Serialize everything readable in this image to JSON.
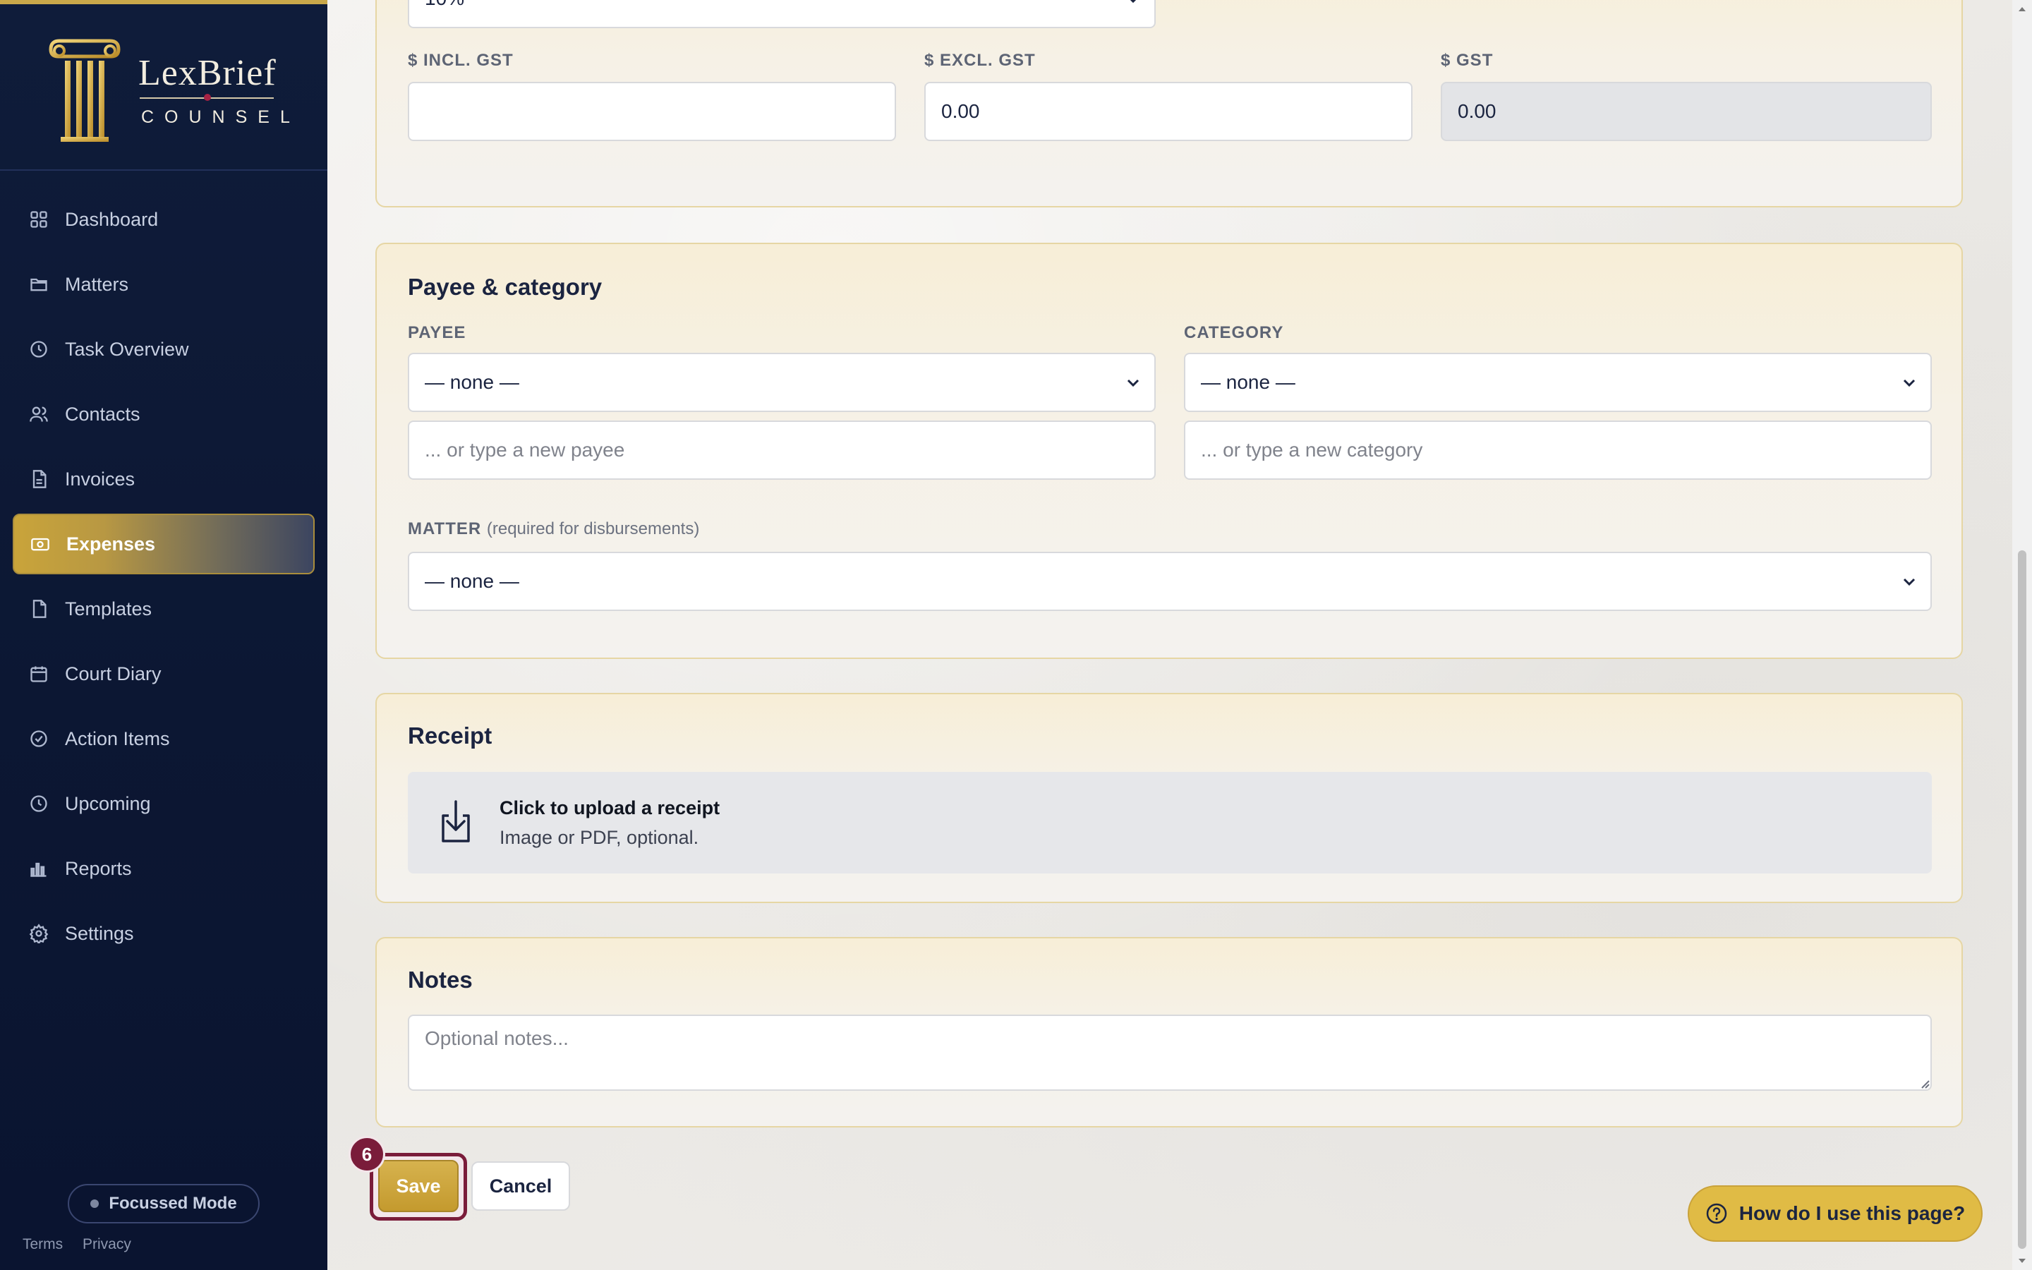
{
  "brand": {
    "name": "LexBrief",
    "subtitle": "COUNSEL"
  },
  "nav": [
    {
      "label": "Dashboard",
      "icon": "grid-icon"
    },
    {
      "label": "Matters",
      "icon": "folder-icon"
    },
    {
      "label": "Task Overview",
      "icon": "clock-icon"
    },
    {
      "label": "Contacts",
      "icon": "people-icon"
    },
    {
      "label": "Invoices",
      "icon": "document-icon"
    },
    {
      "label": "Expenses",
      "icon": "money-icon",
      "active": true
    },
    {
      "label": "Templates",
      "icon": "file-icon"
    },
    {
      "label": "Court Diary",
      "icon": "calendar-icon"
    },
    {
      "label": "Action Items",
      "icon": "check-circle-icon"
    },
    {
      "label": "Upcoming",
      "icon": "clock-icon"
    },
    {
      "label": "Reports",
      "icon": "bar-chart-icon"
    },
    {
      "label": "Settings",
      "icon": "gear-icon"
    }
  ],
  "sidebar_footer": {
    "focus_mode": "Focussed Mode",
    "terms": "Terms",
    "privacy": "Privacy"
  },
  "amounts": {
    "gst_rate_value": "10%",
    "incl_label": "$ INCL. GST",
    "incl_value": "",
    "excl_label": "$ EXCL. GST",
    "excl_value": "0.00",
    "gst_label": "$ GST",
    "gst_value": "0.00"
  },
  "payee_category": {
    "title": "Payee & category",
    "payee_label": "PAYEE",
    "payee_selected": "— none —",
    "payee_new_placeholder": "... or type a new payee",
    "category_label": "CATEGORY",
    "category_selected": "— none —",
    "category_new_placeholder": "... or type a new category",
    "matter_label": "MATTER",
    "matter_hint": "(required for disbursements)",
    "matter_selected": "— none —"
  },
  "receipt": {
    "title": "Receipt",
    "upload_title": "Click to upload a receipt",
    "upload_sub": "Image or PDF, optional."
  },
  "notes": {
    "title": "Notes",
    "placeholder": "Optional notes..."
  },
  "actions": {
    "save": "Save",
    "cancel": "Cancel",
    "step_badge": "6",
    "help": "How do I use this page?"
  },
  "colors": {
    "sidebar_bg": "#0f1c3a",
    "accent_gold": "#c9a43a",
    "badge_maroon": "#7a1c3a"
  }
}
